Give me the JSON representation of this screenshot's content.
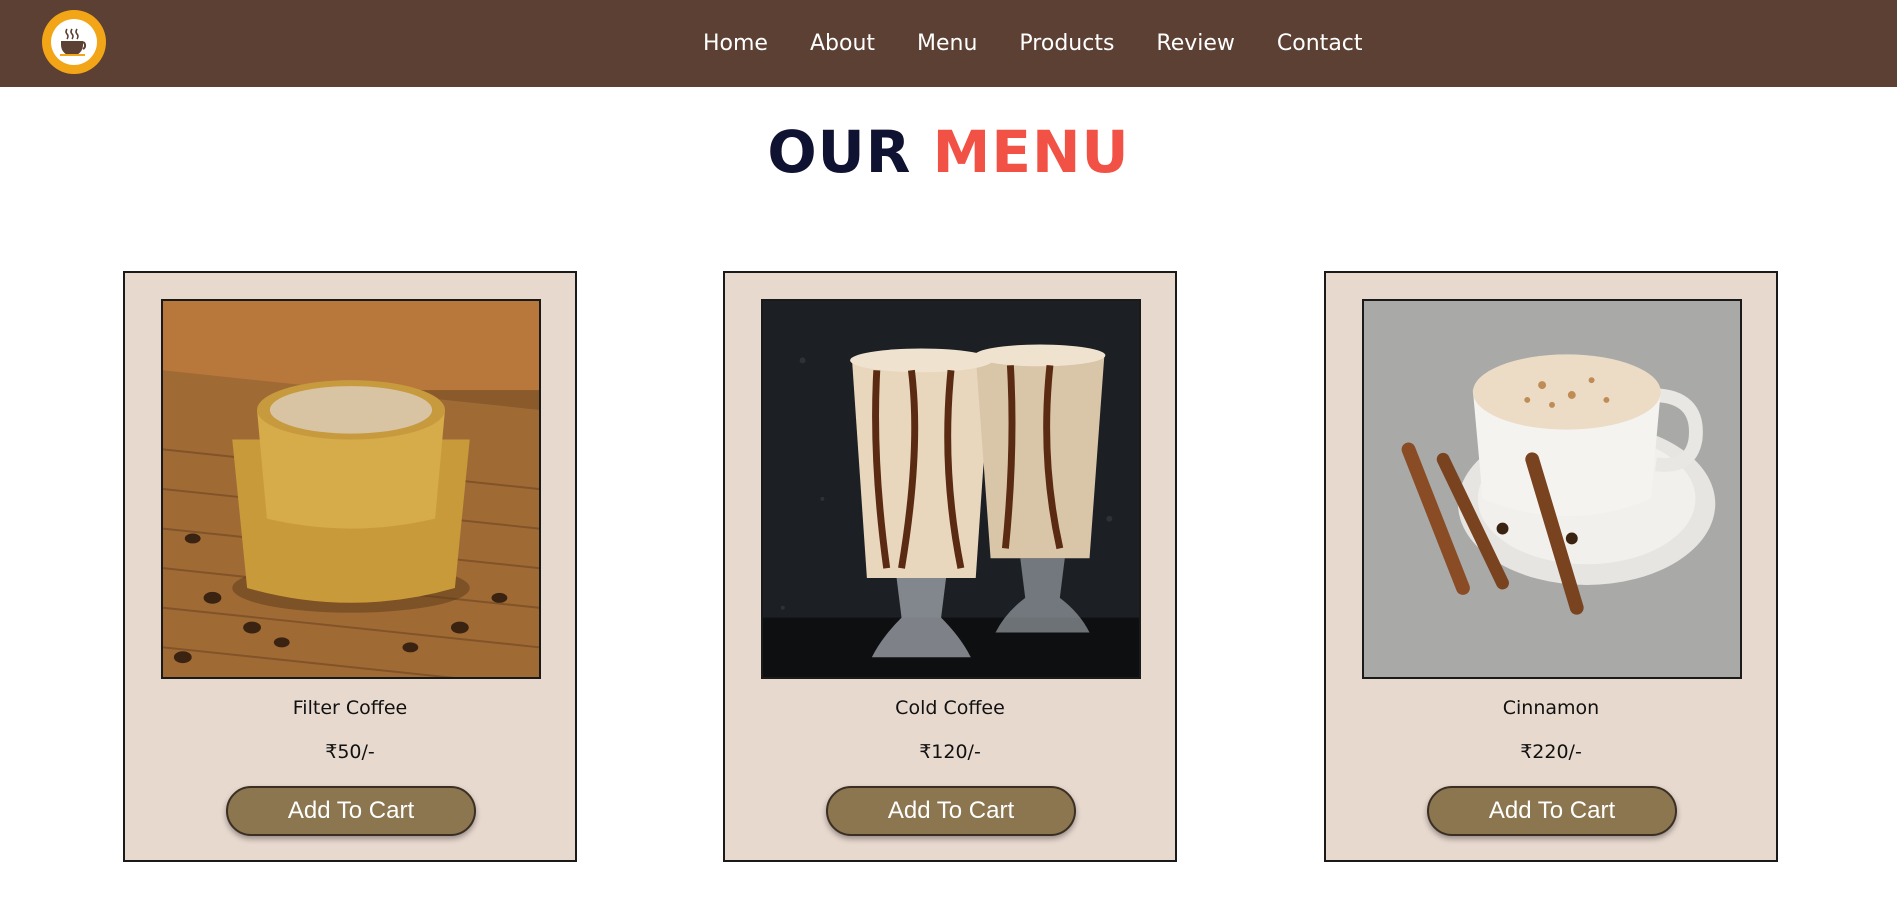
{
  "colors": {
    "navbar_bg": "#5c4033",
    "heading_dark": "#0f1230",
    "heading_accent": "#f25245",
    "card_bg": "#e8d9cf",
    "button_bg": "#8b7650",
    "logo": "#f2a516"
  },
  "nav": {
    "logo_icon": "coffee-cup-logo",
    "links": [
      "Home",
      "About",
      "Menu",
      "Products",
      "Review",
      "Contact"
    ]
  },
  "section": {
    "title_part1": "OUR",
    "title_part2": "MENU"
  },
  "menu_items": [
    {
      "name": "Filter Coffee",
      "price": "₹50/-",
      "button_label": "Add To Cart",
      "image": "filter-coffee-photo"
    },
    {
      "name": "Cold Coffee",
      "price": "₹120/-",
      "button_label": "Add To Cart",
      "image": "cold-coffee-photo"
    },
    {
      "name": "Cinnamon",
      "price": "₹220/-",
      "button_label": "Add To Cart",
      "image": "cinnamon-coffee-photo"
    }
  ]
}
